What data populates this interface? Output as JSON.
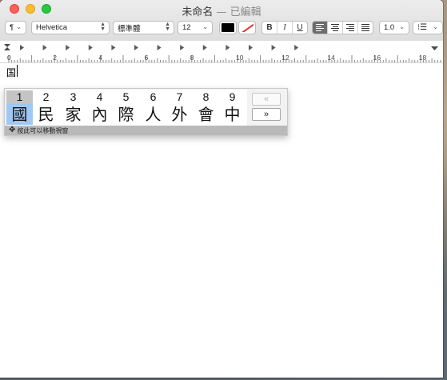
{
  "window": {
    "title": "未命名",
    "separator": "—",
    "status": "已編輯"
  },
  "toolbar": {
    "paragraph_style": "¶",
    "font_family": "Helvetica",
    "typeface": "標準體",
    "font_size": "12",
    "text_color": "#000000",
    "bold_label": "B",
    "italic_label": "I",
    "underline_label": "U",
    "line_spacing": "1.0",
    "list_icon": "list-bullets-icon",
    "active_alignment": "left"
  },
  "ruler": {
    "labels": [
      "0",
      "2",
      "4",
      "6",
      "8",
      "10",
      "12",
      "14",
      "16",
      "18"
    ]
  },
  "document": {
    "text": "国"
  },
  "ime": {
    "candidates": [
      {
        "number": "1",
        "char": "國"
      },
      {
        "number": "2",
        "char": "民"
      },
      {
        "number": "3",
        "char": "家"
      },
      {
        "number": "4",
        "char": "內"
      },
      {
        "number": "5",
        "char": "際"
      },
      {
        "number": "6",
        "char": "人"
      },
      {
        "number": "7",
        "char": "外"
      },
      {
        "number": "8",
        "char": "會"
      },
      {
        "number": "9",
        "char": "中"
      }
    ],
    "selected_index": 0,
    "prev_page_label": "«",
    "next_page_label": "»",
    "footer_hint": "按此可以移動視窗"
  }
}
